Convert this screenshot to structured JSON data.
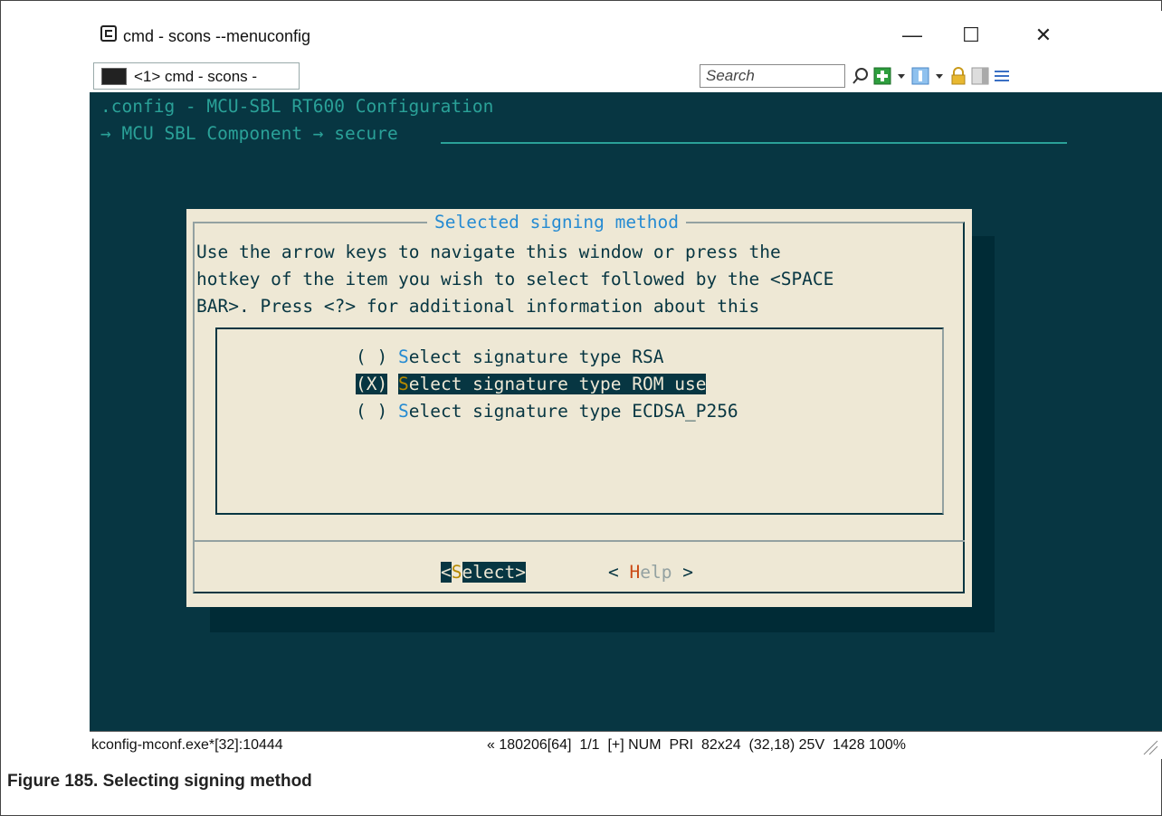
{
  "window": {
    "title": "cmd - scons --menuconfig",
    "minimize": "—",
    "maximize": "☐",
    "close": "✕"
  },
  "tab": {
    "label": "<1> cmd - scons -"
  },
  "toolbar": {
    "search_placeholder": "Search"
  },
  "terminal": {
    "line1": ".config - MCU-SBL RT600 Configuration",
    "line2": "→ MCU SBL Component → secure"
  },
  "dialog": {
    "title": "Selected signing method",
    "help_lines": [
      "Use the arrow keys to navigate this window or press the",
      "hotkey of the item you wish to select followed by the <SPACE",
      "BAR>. Press <?> for additional information about this"
    ],
    "options": [
      {
        "mark": "( )",
        "hotkey": "S",
        "rest": "elect signature type RSA",
        "selected": false
      },
      {
        "mark": "(X)",
        "hotkey": "S",
        "rest": "elect signature type ROM use",
        "selected": true
      },
      {
        "mark": "( )",
        "hotkey": "S",
        "rest": "elect signature type ECDSA_P256",
        "selected": false
      }
    ],
    "select_button": {
      "open": "<",
      "hotkey": "S",
      "rest": "elect",
      "close": ">"
    },
    "help_button": {
      "open": "< ",
      "hotkey": "H",
      "rest": "elp",
      "close": " >"
    }
  },
  "statusbar": {
    "process": "kconfig-mconf.exe*[32]:10444",
    "info": "« 180206[64]  1/1  [+] NUM  PRI  82x24  (32,18) 25V  1428 100%"
  },
  "caption": "Figure 185. Selecting signing method",
  "colors": {
    "terminal_bg": "#073642",
    "dialog_bg": "#eee8d5",
    "accent_cyan": "#2aa198",
    "hotkey_blue": "#268bd2",
    "hotkey_orange": "#cb4b16",
    "selected_hotkey": "#b58900"
  }
}
